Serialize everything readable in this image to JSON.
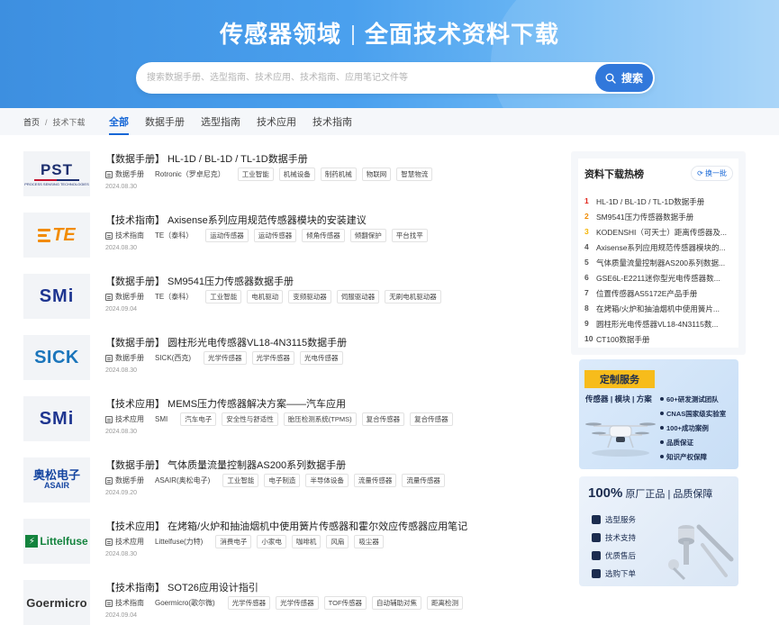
{
  "hero": {
    "title_left": "传感器领域",
    "title_right": "全面技术资料下载",
    "search_placeholder": "搜索数据手册、选型指南、技术应用、技术指南、应用笔记文件等",
    "search_button": "搜索"
  },
  "breadcrumb": {
    "home": "首页",
    "separator": "/",
    "current": "技术下载"
  },
  "tabs": [
    "全部",
    "数据手册",
    "选型指南",
    "技术应用",
    "技术指南"
  ],
  "active_tab": "全部",
  "documents": [
    {
      "title": "【数据手册】 HL-1D / BL-1D / TL-1D数据手册",
      "category": "数据手册",
      "brand": "Rotronic（罗卓尼克）",
      "tags": [
        "工业智能",
        "机械设备",
        "制药机械",
        "物联网",
        "智慧物流"
      ],
      "date": "2024.08.30",
      "logo": "PST"
    },
    {
      "title": "【技术指南】 Axisense系列应用规范传感器模块的安装建议",
      "category": "技术指南",
      "brand": "TE（泰科）",
      "tags": [
        "运动传感器",
        "运动传感器",
        "倾角传感器",
        "倾翻保护",
        "平台找平"
      ],
      "date": "2024.08.30",
      "logo": "TE"
    },
    {
      "title": "【数据手册】 SM9541压力传感器数据手册",
      "category": "数据手册",
      "brand": "TE（泰科）",
      "tags": [
        "工业智能",
        "电机驱动",
        "变频驱动器",
        "伺服驱动器",
        "无刷电机驱动器"
      ],
      "date": "2024.09.04",
      "logo": "SMi"
    },
    {
      "title": "【数据手册】 圆柱形光电传感器VL18-4N3115数据手册",
      "category": "数据手册",
      "brand": "SICK(西克)",
      "tags": [
        "光学传感器",
        "光学传感器",
        "光电传感器"
      ],
      "date": "2024.08.30",
      "logo": "SICK"
    },
    {
      "title": "【技术应用】 MEMS压力传感器解决方案——汽车应用",
      "category": "技术应用",
      "brand": "SMI",
      "tags": [
        "汽车电子",
        "安全性与舒适性",
        "胎压检测系统(TPMS)",
        "复合传感器",
        "复合传感器"
      ],
      "date": "2024.08.30",
      "logo": "SMi"
    },
    {
      "title": "【数据手册】 气体质量流量控制器AS200系列数据手册",
      "category": "数据手册",
      "brand": "ASAIR(奥松电子)",
      "tags": [
        "工业智能",
        "电子制造",
        "半导体设备",
        "流量传感器",
        "流量传感器"
      ],
      "date": "2024.09.20",
      "logo": "ASAIR"
    },
    {
      "title": "【技术应用】 在烤箱/火炉和抽油烟机中使用簧片传感器和霍尔效应传感器应用笔记",
      "category": "技术应用",
      "brand": "Littelfuse(力特)",
      "tags": [
        "消费电子",
        "小家电",
        "咖啡机",
        "风扇",
        "吸尘器"
      ],
      "date": "2024.08.30",
      "logo": "Littelfuse"
    },
    {
      "title": "【技术指南】 SOT26应用设计指引",
      "category": "技术指南",
      "brand": "Goermicro(歌尔微)",
      "tags": [
        "光学传感器",
        "光学传感器",
        "TOF传感器",
        "自动辅助对焦",
        "距离检测"
      ],
      "date": "2024.09.04",
      "logo": "Goermicro"
    }
  ],
  "logos": {
    "pst_big": "PST",
    "pst_small": "PROCESS SENSING TECHNOLOGIES",
    "te": "TE",
    "smi": "SMi",
    "sick": "SICK",
    "asair_cn": "奥松电子",
    "asair_en": "ASAIR",
    "littelfuse": "Littelfuse",
    "goermicro": "Goermicro"
  },
  "ranking": {
    "title": "资料下载热榜",
    "refresh": "换一批",
    "items": [
      "HL-1D / BL-1D / TL-1D数据手册",
      "SM9541压力传感器数据手册",
      "KODENSHI（可天士）距离传感器及...",
      "Axisense系列应用规范传感器模块的...",
      "气体质量流量控制器AS200系列数据...",
      "GSE6L-E2211迷你型光电传感器数...",
      "位置传感器AS5172E产品手册",
      "在烤箱/火炉和抽油烟机中使用簧片...",
      "圆柱形光电传感器VL18-4N3115数...",
      "CT100数据手册"
    ]
  },
  "service": {
    "title": "定制服务",
    "subtitle": "传感器 | 模块 | 方案",
    "points": [
      "60+研发测试团队",
      "CNAS国家级实验室",
      "100+成功案例",
      "品质保证",
      "知识产权保障"
    ]
  },
  "genuine": {
    "title_strong": "100%",
    "title_rest": "原厂正品 | 品质保障",
    "items": [
      "选型服务",
      "技术支持",
      "优质售后",
      "选购下单"
    ]
  }
}
